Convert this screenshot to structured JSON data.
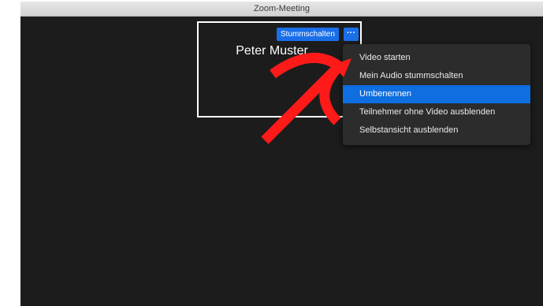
{
  "window": {
    "title": "Zoom-Meeting"
  },
  "video_tile": {
    "participant_name": "Peter Muster",
    "mute_button_label": "Stummschalten",
    "more_button_label": "···"
  },
  "context_menu": {
    "items": [
      {
        "label": "Video starten",
        "highlighted": false
      },
      {
        "label": "Mein Audio stummschalten",
        "highlighted": false
      },
      {
        "label": "Umbenennen",
        "highlighted": true
      },
      {
        "label": "Teilnehmer ohne Video ausblenden",
        "highlighted": false
      },
      {
        "label": "Selbstansicht ausblenden",
        "highlighted": false
      }
    ]
  },
  "colors": {
    "accent": "#1a6fe8",
    "highlight": "#0f6ee0",
    "annotation_arrow": "#ff1a1a",
    "background": "#1c1c1c"
  },
  "icons": {
    "annotation": "red-curved-arrow-icon"
  }
}
